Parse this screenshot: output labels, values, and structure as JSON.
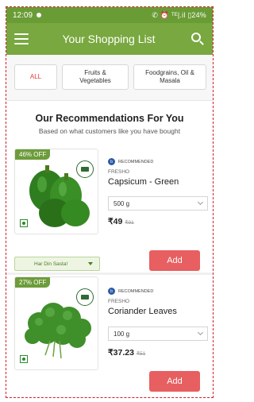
{
  "status_bar": {
    "time": "12:09",
    "right_text": "✆ ⏰ ᵀᴱ|.il ▯24%"
  },
  "app_bar": {
    "title": "Your Shopping List"
  },
  "filters": [
    {
      "label": "ALL"
    },
    {
      "label": "Fruits &\nVegetables"
    },
    {
      "label": "Foodgrains, Oil &\nMasala"
    }
  ],
  "recommendations": {
    "title": "Our Recommendations For You",
    "subtitle": "Based on what customers like you have bought"
  },
  "products": [
    {
      "offer": "46% OFF",
      "badge": "RECOMMENDED",
      "brand": "FRESHO",
      "name": "Capsicum - Green",
      "qty": "500 g",
      "price": "₹49",
      "mrp": "₹91",
      "saste_label": "Har Din Sasta!",
      "add_label": "Add"
    },
    {
      "offer": "27% OFF",
      "badge": "RECOMMENDED",
      "brand": "FRESHO",
      "name": "Coriander Leaves",
      "qty": "100 g",
      "price": "₹37.23",
      "mrp": "₹51",
      "add_label": "Add"
    }
  ],
  "colors": {
    "app_bar": "#78a83f",
    "status_bar": "#6a9c36",
    "offer_badge": "#6d9c3a",
    "add_button": "#e75f60",
    "active_filter": "#e23a36"
  }
}
